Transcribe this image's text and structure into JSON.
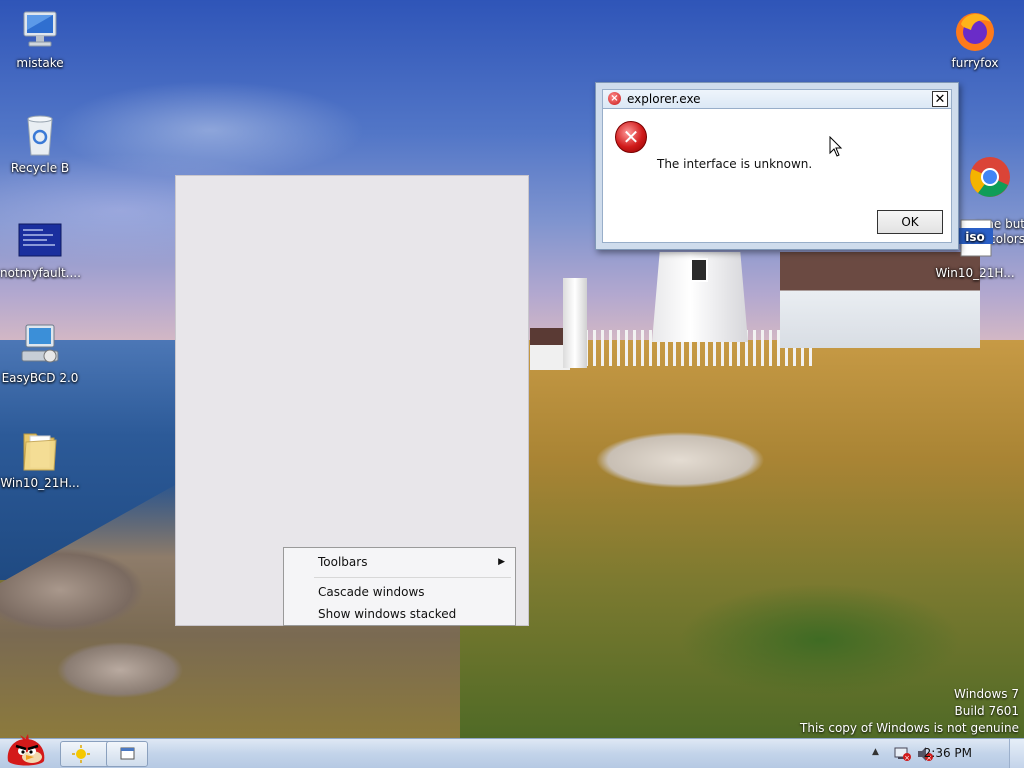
{
  "desktop": {
    "icons": [
      {
        "label": "mistake",
        "icon": "computer-icon"
      },
      {
        "label": "Recycle B",
        "icon": "recycle-bin-icon"
      },
      {
        "label": "notmyfault....",
        "icon": "bsod-thumbnail-icon"
      },
      {
        "label": "EasyBCD 2.0",
        "icon": "easybcd-icon"
      },
      {
        "label": "Win10_21H...",
        "icon": "folder-icon"
      },
      {
        "label": "furryfox",
        "icon": "firefox-icon"
      },
      {
        "label": "ome but\nnal colors",
        "icon": "chrome-icon"
      },
      {
        "label": "Win10_21H...",
        "icon": "iso-file-icon"
      }
    ]
  },
  "context_menu": {
    "items": [
      {
        "label": "Toolbars",
        "has_submenu": true
      },
      {
        "label": "Cascade windows",
        "has_submenu": false
      },
      {
        "label": "Show windows stacked",
        "has_submenu": false
      }
    ]
  },
  "dialog": {
    "title": "explorer.exe",
    "message": "The interface is unknown.",
    "ok_label": "OK",
    "close_label": "✕"
  },
  "watermark": {
    "line1": "Windows 7",
    "line2": "Build 7601",
    "line3": "This copy of Windows is not genuine"
  },
  "taskbar": {
    "clock": "2:36 PM",
    "tray_up_arrow": "▲"
  },
  "colors": {
    "dialog_frame": "#cfdcec",
    "error_red": "#d01a1a",
    "taskbar": "#c3d4ea"
  }
}
